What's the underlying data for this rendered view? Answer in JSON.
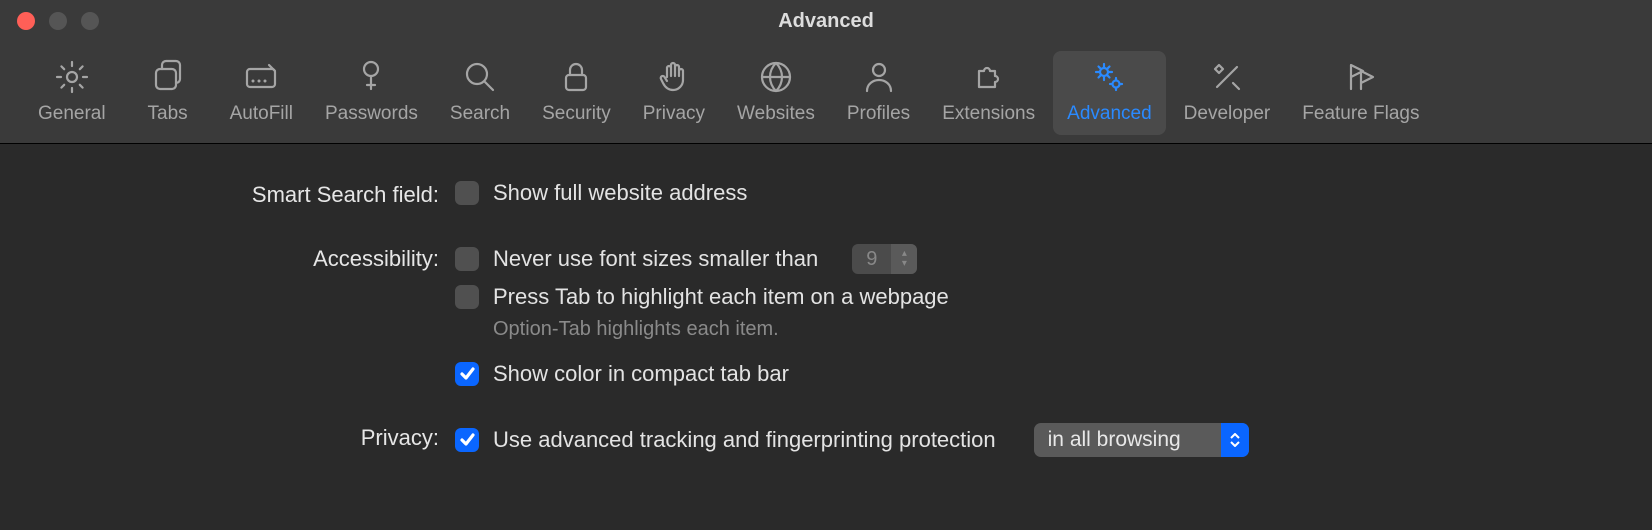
{
  "window": {
    "title": "Advanced"
  },
  "toolbar": {
    "items": [
      {
        "label": "General"
      },
      {
        "label": "Tabs"
      },
      {
        "label": "AutoFill"
      },
      {
        "label": "Passwords"
      },
      {
        "label": "Search"
      },
      {
        "label": "Security"
      },
      {
        "label": "Privacy"
      },
      {
        "label": "Websites"
      },
      {
        "label": "Profiles"
      },
      {
        "label": "Extensions"
      },
      {
        "label": "Advanced"
      },
      {
        "label": "Developer"
      },
      {
        "label": "Feature Flags"
      }
    ]
  },
  "sections": {
    "smart_search": {
      "label": "Smart Search field:",
      "show_full_address": "Show full website address"
    },
    "accessibility": {
      "label": "Accessibility:",
      "min_font": "Never use font sizes smaller than",
      "min_font_value": "9",
      "tab_highlight": "Press Tab to highlight each item on a webpage",
      "tab_hint": "Option-Tab highlights each item.",
      "compact_color": "Show color in compact tab bar"
    },
    "privacy": {
      "label": "Privacy:",
      "tracking": "Use advanced tracking and fingerprinting protection",
      "tracking_scope": "in all browsing"
    }
  }
}
